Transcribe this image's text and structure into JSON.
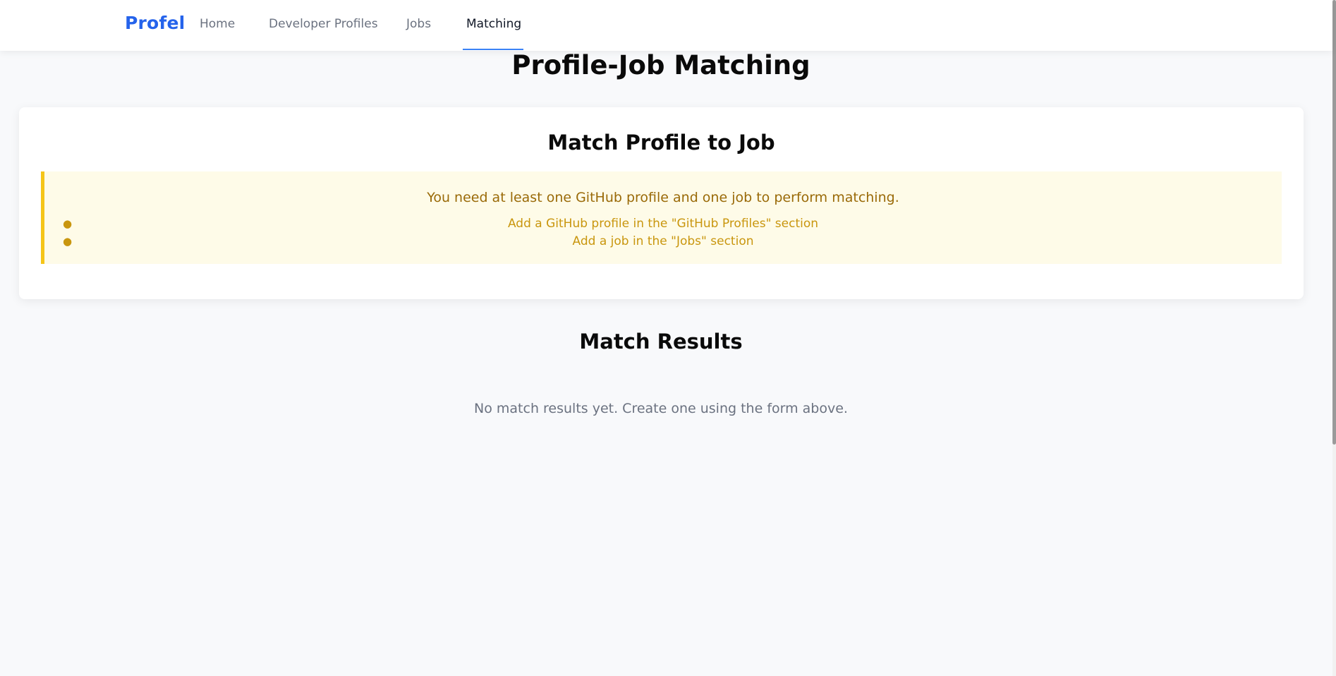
{
  "nav": {
    "brand": "Profel",
    "links": [
      {
        "label": "Home",
        "active": false
      },
      {
        "label": "Developer Profiles",
        "active": false
      },
      {
        "label": "Jobs",
        "active": false
      },
      {
        "label": "Matching",
        "active": true
      }
    ]
  },
  "page": {
    "title": "Profile-Job Matching"
  },
  "match_card": {
    "title": "Match Profile to Job",
    "warning": {
      "message": "You need at least one GitHub profile and one job to perform matching.",
      "items": [
        "Add a GitHub profile in the \"GitHub Profiles\" section",
        "Add a job in the \"Jobs\" section"
      ]
    }
  },
  "results": {
    "title": "Match Results",
    "empty_message": "No match results yet. Create one using the form above."
  },
  "colors": {
    "brand": "#2563eb",
    "active_underline": "#3b82f6",
    "warning_bg": "#fefbe8",
    "warning_border": "#f5c518",
    "warning_text": "#9a6a08"
  }
}
